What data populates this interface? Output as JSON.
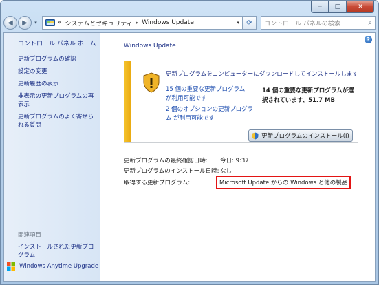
{
  "window": {
    "caption": {
      "minimize": "─",
      "maximize": "□",
      "close": "✕"
    }
  },
  "navigation": {
    "back": "◀",
    "forward": "▶",
    "address": {
      "chevrons": "«",
      "segments": [
        "システムとセキュリティ",
        "Windows Update"
      ],
      "separator": "▸",
      "dropdown": "▾"
    },
    "refresh": "⟳",
    "search": {
      "placeholder": "コントロール パネルの検索",
      "icon": "⌕"
    }
  },
  "help_label": "?",
  "sidebar": {
    "home": "コントロール パネル ホーム",
    "links": [
      "更新プログラムの確認",
      "設定の変更",
      "更新履歴の表示",
      "非表示の更新プログラムの再表示",
      "更新プログラムのよく寄せられる質問"
    ],
    "see_also_title": "関連項目",
    "see_also": [
      "インストールされた更新プログラム"
    ],
    "anytime_upgrade": "Windows Anytime Upgrade"
  },
  "main": {
    "title": "Windows Update",
    "status": {
      "heading": "更新プログラムをコンピューターにダウンロードしてインストールします",
      "important_link": "15 個の重要な更新プログラムが利用可能です",
      "optional_link": "2 個のオプションの更新プログラム が利用可能です",
      "selected_summary": "14 個の重要な更新プログラムが選択されています、51.7 MB",
      "install_button": "更新プログラムのインストール(I)"
    },
    "info": [
      {
        "label": "更新プログラムの最終確認日時:",
        "value": "今日: 9:37"
      },
      {
        "label": "更新プログラムのインストール日時:",
        "value": "なし"
      },
      {
        "label": "取得する更新プログラム:",
        "value": "Microsoft Update からの Windows と他の製品"
      }
    ]
  },
  "colors": {
    "link": "#1e3287",
    "warning_bar": "#f4c12a",
    "highlight_border": "#e31414"
  }
}
